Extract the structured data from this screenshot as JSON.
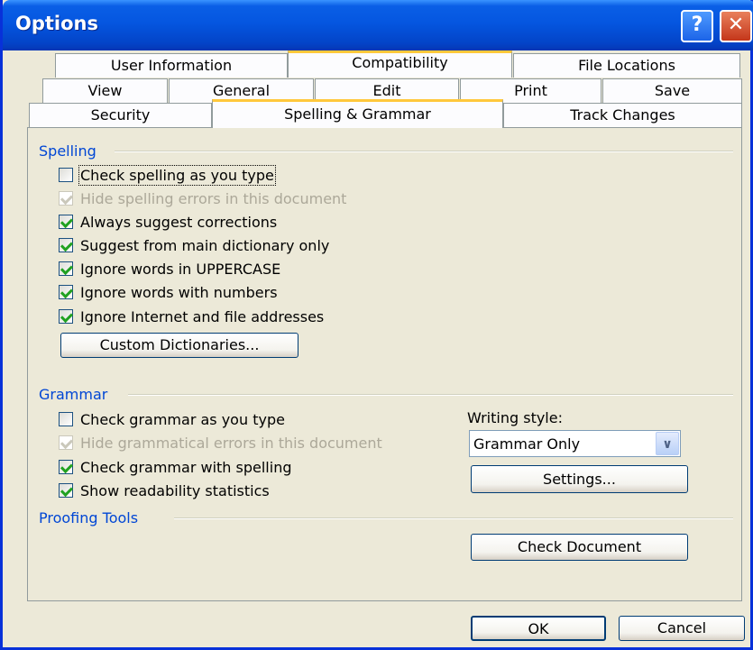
{
  "window": {
    "title": "Options"
  },
  "title_buttons": {
    "help": "?",
    "close": "✕"
  },
  "tabs": {
    "row1": [
      "User Information",
      "Compatibility",
      "File Locations"
    ],
    "row2": [
      "View",
      "General",
      "Edit",
      "Print",
      "Save"
    ],
    "row3": [
      "Security",
      "Spelling & Grammar",
      "Track Changes"
    ],
    "selected": "Spelling & Grammar"
  },
  "spelling": {
    "group_label": "Spelling",
    "options": [
      {
        "label": "Check spelling as you type",
        "checked": false,
        "enabled": true
      },
      {
        "label": "Hide spelling errors in this document",
        "checked": true,
        "enabled": false
      },
      {
        "label": "Always suggest corrections",
        "checked": true,
        "enabled": true
      },
      {
        "label": "Suggest from main dictionary only",
        "checked": true,
        "enabled": true
      },
      {
        "label": "Ignore words in UPPERCASE",
        "checked": true,
        "enabled": true
      },
      {
        "label": "Ignore words with numbers",
        "checked": true,
        "enabled": true
      },
      {
        "label": "Ignore Internet and file addresses",
        "checked": true,
        "enabled": true
      }
    ],
    "custom_dictionaries_label": "Custom Dictionaries..."
  },
  "grammar": {
    "group_label": "Grammar",
    "options": [
      {
        "label": "Check grammar as you type",
        "checked": false,
        "enabled": true
      },
      {
        "label": "Hide grammatical errors in this document",
        "checked": true,
        "enabled": false
      },
      {
        "label": "Check grammar with spelling",
        "checked": true,
        "enabled": true
      },
      {
        "label": "Show readability statistics",
        "checked": true,
        "enabled": true
      }
    ],
    "writing_style_label": "Writing style:",
    "writing_style_value": "Grammar Only",
    "settings_label": "Settings..."
  },
  "proofing": {
    "group_label": "Proofing Tools",
    "check_document_label": "Check Document"
  },
  "footer": {
    "ok_label": "OK",
    "cancel_label": "Cancel"
  }
}
